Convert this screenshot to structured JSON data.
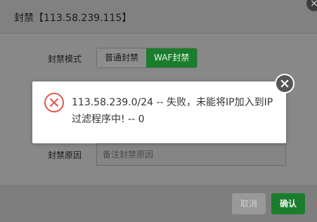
{
  "dialog": {
    "title": "封禁【113.58.239.115】",
    "mode_label": "封禁模式",
    "mode_options": [
      "普通封禁",
      "WAF封禁"
    ],
    "mode_selected": "WAF封禁",
    "reason_label": "封禁原因",
    "reason_placeholder": "备注封禁原因",
    "cancel_label": "取消",
    "ok_label": "确认"
  },
  "toast": {
    "line1": "113.58.239.0/24 -- 失败，未能将IP加入到IP",
    "line2": "过滤程序中! -- 0",
    "icon": "error-circle-x-icon",
    "accent": "#e05a4f"
  },
  "colors": {
    "primary_green": "#1a7d2c"
  }
}
